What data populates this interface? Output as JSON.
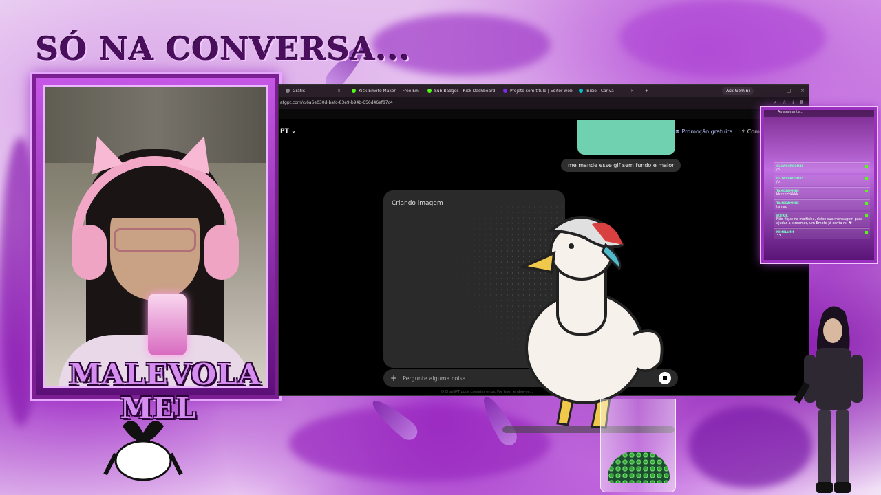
{
  "overlay": {
    "title": "SÓ NA CONVERSA...",
    "brand": "MALEVOLA MEL"
  },
  "browser": {
    "tabs": [
      {
        "label": "Grátis",
        "color": "#888888"
      },
      {
        "label": "Kick Emote Maker — Free Em",
        "color": "#53fc18"
      },
      {
        "label": "Sub Badges - Kick Dashboard",
        "color": "#53fc18"
      },
      {
        "label": "Projeto sem título | Editor web",
        "color": "#7d2ae8"
      },
      {
        "label": "Início - Canva",
        "color": "#00c4cc"
      }
    ],
    "new_tab": "+",
    "gemini_button": "Ask Gemini",
    "url": "atgpt.com/c/6a6e030d-bafc-83e9-b94b-656d46ef87c4"
  },
  "chatgpt": {
    "model_label": "PT",
    "promo_label": "Promoção gratuita",
    "share_label": "Compartilhar",
    "user_message": "me mande esse gif sem fundo e maior",
    "image_status": "Criando imagem",
    "composer_placeholder": "Pergunte alguma coisa",
    "disclaimer": "O ChatGPT pode cometer erros. Por isso, lembre-se..."
  },
  "chat_overlay": {
    "header": "Ao assinante...",
    "messages": [
      {
        "user": "GLOWSHROOM45",
        "text": "/o"
      },
      {
        "user": "GLOWSHROOM45",
        "text": "/o"
      },
      {
        "user": "TAMOSAMMHE",
        "text": "kkkkkkkkkkk"
      },
      {
        "user": "TAMOSAMMHE",
        "text": "ta nao"
      },
      {
        "user": "BOTKIK",
        "text": "Não fique na moitinha, deixe sua mensagem para ajudar a streamer, um Emote já conta rs! ♥"
      },
      {
        "user": "MIMINAMM",
        "text": "33"
      }
    ]
  },
  "colors": {
    "purple_dark": "#4a0f5c",
    "purple": "#9b2fc0",
    "kick_green": "#53fc18"
  }
}
